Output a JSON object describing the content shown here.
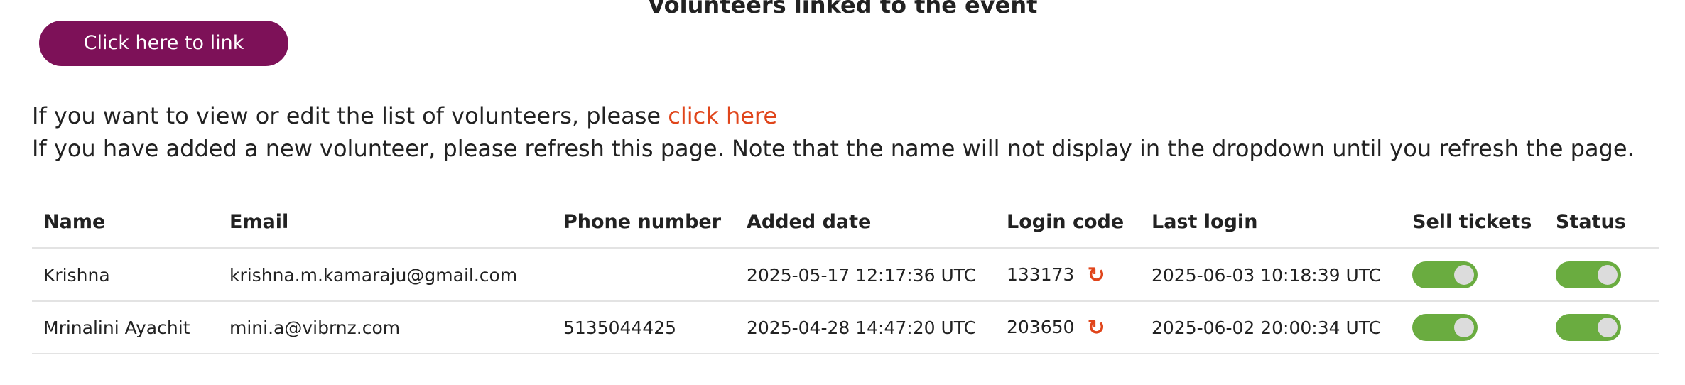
{
  "header": {
    "title": "Volunteers linked to the event",
    "link_button": "Click here to link"
  },
  "info": {
    "line1_text": "If you want to view or edit the list of volunteers, please ",
    "line1_link": "click here",
    "line2_text": "If you have added a new volunteer, please refresh this page. Note that the name will not display in the dropdown until you refresh the page."
  },
  "table": {
    "columns": [
      "Name",
      "Email",
      "Phone number",
      "Added date",
      "Login code",
      "Last login",
      "Sell tickets",
      "Status"
    ],
    "rows": [
      {
        "name": "Krishna",
        "email": "krishna.m.kamaraju@gmail.com",
        "phone": "",
        "added": "2025-05-17 12:17:36 UTC",
        "code": "133173",
        "last_login": "2025-06-03 10:18:39 UTC",
        "sell_tickets": true,
        "status": true
      },
      {
        "name": "Mrinalini Ayachit",
        "email": "mini.a@vibrnz.com",
        "phone": "5135044425",
        "added": "2025-04-28 14:47:20 UTC",
        "code": "203650",
        "last_login": "2025-06-02 20:00:34 UTC",
        "sell_tickets": true,
        "status": true
      }
    ]
  },
  "colors": {
    "button_bg": "#7d1158",
    "link": "#e0451b",
    "toggle_on": "#6aac40"
  },
  "icons": {
    "refresh": "refresh-icon"
  }
}
